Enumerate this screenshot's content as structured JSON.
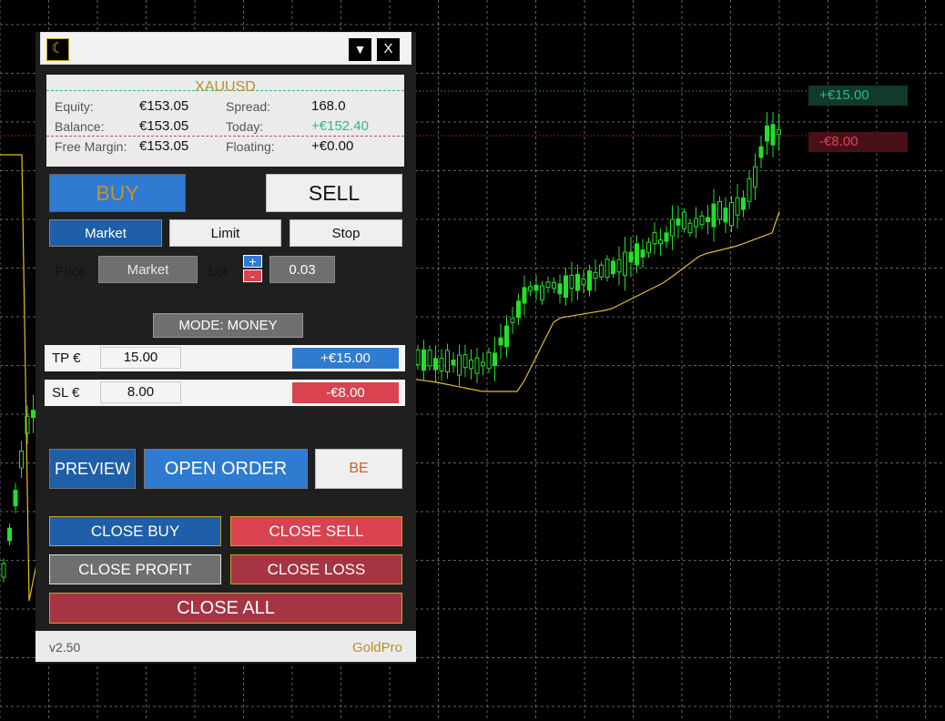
{
  "chart": {
    "tp_tag": "+€15.00",
    "sl_tag": "-€8.00",
    "colors": {
      "background": "#000000",
      "grid": "#8a8a8a",
      "candle": "#22e02a",
      "ma": "#e0c020"
    }
  },
  "panel": {
    "icons": {
      "theme": "moon-icon",
      "minimize": "triangle-down-icon",
      "close": "close-icon"
    },
    "minimize_label": "▼",
    "close_label": "X",
    "info": {
      "symbol": "XAUUSD",
      "equity_label": "Equity:",
      "equity_value": "€153.05",
      "balance_label": "Balance:",
      "balance_value": "€153.05",
      "free_margin_label": "Free Margin:",
      "free_margin_value": "€153.05",
      "spread_label": "Spread:",
      "spread_value": "168.0",
      "today_label": "Today:",
      "today_value": "+€152.40",
      "floating_label": "Floating:",
      "floating_value": "+€0.00"
    },
    "buy_label": "BUY",
    "sell_label": "SELL",
    "order_types": {
      "market": "Market",
      "limit": "Limit",
      "stop": "Stop"
    },
    "price_label": "Price",
    "price_value": "Market",
    "lot_label": "Lot",
    "lot_plus": "+",
    "lot_minus": "-",
    "lot_value": "0.03",
    "mode_label": "MODE: MONEY",
    "tp": {
      "label": "TP €",
      "input": "15.00",
      "value": "+€15.00"
    },
    "sl": {
      "label": "SL €",
      "input": "8.00",
      "value": "-€8.00"
    },
    "preview_label": "PREVIEW",
    "open_order_label": "OPEN ORDER",
    "be_label": "BE",
    "close_buy_label": "CLOSE BUY",
    "close_sell_label": "CLOSE SELL",
    "close_profit_label": "CLOSE PROFIT",
    "close_loss_label": "CLOSE LOSS",
    "close_all_label": "CLOSE ALL",
    "version": "v2.50",
    "brand": "GoldPro",
    "colors": {
      "accent_blue": "#2e7bd1",
      "accent_red": "#d9434f",
      "gold": "#b8902a",
      "profit_green": "#2fb98a"
    }
  }
}
